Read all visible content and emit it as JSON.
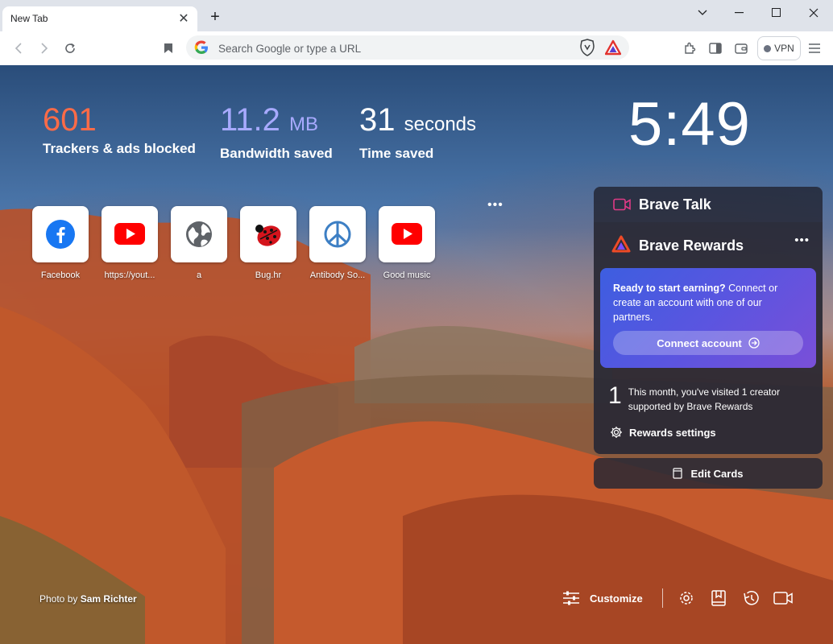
{
  "tab": {
    "title": "New Tab"
  },
  "omnibox": {
    "placeholder": "Search Google or type a URL"
  },
  "vpn": {
    "label": "VPN"
  },
  "stats": [
    {
      "value": "601",
      "unit": "",
      "label": "Trackers & ads blocked",
      "color": "#ff6b47"
    },
    {
      "value": "11.2",
      "unit": "MB",
      "label": "Bandwidth saved",
      "color": "#a8aaff"
    },
    {
      "value": "31",
      "unit": "seconds",
      "label": "Time saved",
      "color": "#ffffff"
    }
  ],
  "clock": "5:49",
  "top_sites": [
    {
      "label": "Facebook",
      "icon": "facebook-icon"
    },
    {
      "label": "https://yout...",
      "icon": "youtube-icon"
    },
    {
      "label": "a",
      "icon": "globe-icon"
    },
    {
      "label": "Bug.hr",
      "icon": "ladybug-icon"
    },
    {
      "label": "Antibody So...",
      "icon": "peace-icon"
    },
    {
      "label": "Good music",
      "icon": "youtube-icon"
    }
  ],
  "brave_talk": {
    "title": "Brave Talk"
  },
  "brave_rewards": {
    "title": "Brave Rewards",
    "promo_bold": "Ready to start earning?",
    "promo_text": " Connect or create an account with one of our partners.",
    "connect_label": "Connect account",
    "visited_count": "1",
    "visited_text": "This month, you've visited 1 creator supported by Brave Rewards",
    "settings_label": "Rewards settings"
  },
  "edit_cards": {
    "label": "Edit Cards"
  },
  "photo_credit": {
    "prefix": "Photo by ",
    "author": "Sam Richter"
  },
  "customize": {
    "label": "Customize"
  }
}
